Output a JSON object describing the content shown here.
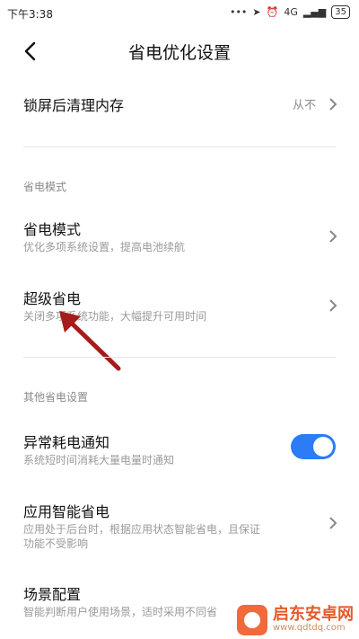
{
  "status": {
    "time": "下午3:38",
    "dots": "•••",
    "signal": "4G",
    "battery": "35"
  },
  "header": {
    "title": "省电优化设置"
  },
  "lock_clean": {
    "label": "锁屏后清理内存",
    "value": "从不"
  },
  "sections": {
    "power_mode": "省电模式",
    "other": "其他省电设置"
  },
  "items": {
    "power_saving": {
      "label": "省电模式",
      "sub": "优化多项系统设置，提高电池续航"
    },
    "ultra_saving": {
      "label": "超级省电",
      "sub": "关闭多项系统功能，大幅提升可用时间"
    },
    "abnormal": {
      "label": "异常耗电通知",
      "sub": "系统短时间消耗大量电量时通知",
      "enabled": true
    },
    "app_smart": {
      "label": "应用智能省电",
      "sub": "应用处于后台时，根据应用状态智能省电，且保证",
      "sub2": "功能不受影响"
    },
    "scene": {
      "label": "场景配置",
      "sub": "智能判断用户使用场景，适时采用不同省"
    }
  },
  "watermark": {
    "name": "启东安卓网",
    "url": "www.qdtdq.com"
  },
  "colors": {
    "toggle_on": "#2b7cf6",
    "arrow": "#a61b1b",
    "watermark": "#e55a2a"
  }
}
